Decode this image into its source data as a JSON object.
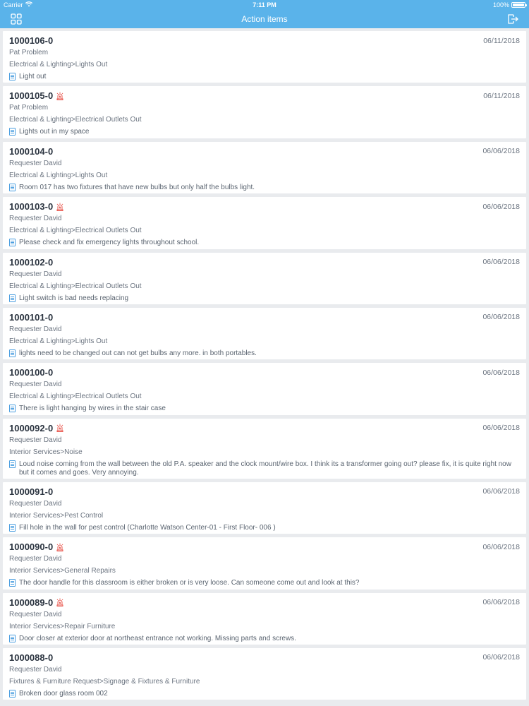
{
  "status": {
    "carrier": "Carrier",
    "time": "7:11 PM",
    "battery": "100%",
    "battery_level": 1.0
  },
  "nav": {
    "title": "Action items"
  },
  "items": [
    {
      "id": "1000106-0",
      "urgent": false,
      "date": "06/11/2018",
      "requester": "Pat Problem",
      "category": "Electrical & Lighting>Lights Out",
      "description": "Light out"
    },
    {
      "id": "1000105-0",
      "urgent": true,
      "date": "06/11/2018",
      "requester": "Pat Problem",
      "category": "Electrical & Lighting>Electrical Outlets Out",
      "description": "Lights out in my space"
    },
    {
      "id": "1000104-0",
      "urgent": false,
      "date": "06/06/2018",
      "requester": "Requester David",
      "category": "Electrical & Lighting>Lights Out",
      "description": "Room 017 has two fixtures that have new bulbs but only half the bulbs light."
    },
    {
      "id": "1000103-0",
      "urgent": true,
      "date": "06/06/2018",
      "requester": "Requester David",
      "category": "Electrical & Lighting>Electrical Outlets Out",
      "description": "Please check and fix emergency lights throughout school."
    },
    {
      "id": "1000102-0",
      "urgent": false,
      "date": "06/06/2018",
      "requester": "Requester David",
      "category": "Electrical & Lighting>Electrical Outlets Out",
      "description": "Light switch is bad needs replacing"
    },
    {
      "id": "1000101-0",
      "urgent": false,
      "date": "06/06/2018",
      "requester": "Requester David",
      "category": "Electrical & Lighting>Lights Out",
      "description": "lights need to be changed out can not get bulbs any more. in both portables."
    },
    {
      "id": "1000100-0",
      "urgent": false,
      "date": "06/06/2018",
      "requester": "Requester David",
      "category": "Electrical & Lighting>Electrical Outlets Out",
      "description": "There is light hanging by wires in the stair case"
    },
    {
      "id": "1000092-0",
      "urgent": true,
      "date": "06/06/2018",
      "requester": "Requester David",
      "category": "Interior Services>Noise",
      "description": "Loud noise coming from the wall between the old P.A. speaker and the clock mount/wire box. I think its a transformer going out? please fix, it is quite right now but it comes and goes. Very annoying."
    },
    {
      "id": "1000091-0",
      "urgent": false,
      "date": "06/06/2018",
      "requester": "Requester David",
      "category": "Interior Services>Pest Control",
      "description": "Fill hole in the wall for pest control (Charlotte Watson Center-01 - First Floor- 006 )"
    },
    {
      "id": "1000090-0",
      "urgent": true,
      "date": "06/06/2018",
      "requester": "Requester David",
      "category": "Interior Services>General Repairs",
      "description": "The door handle for this classroom is either broken or is very loose. Can someone come out and look at this?"
    },
    {
      "id": "1000089-0",
      "urgent": true,
      "date": "06/06/2018",
      "requester": "Requester David",
      "category": "Interior Services>Repair Furniture",
      "description": "Door closer at exterior door at northeast entrance not working. Missing parts and screws."
    },
    {
      "id": "1000088-0",
      "urgent": false,
      "date": "06/06/2018",
      "requester": "Requester David",
      "category": "Fixtures & Furniture Request>Signage & Fixtures & Furniture",
      "description": "Broken door glass room 002"
    }
  ]
}
